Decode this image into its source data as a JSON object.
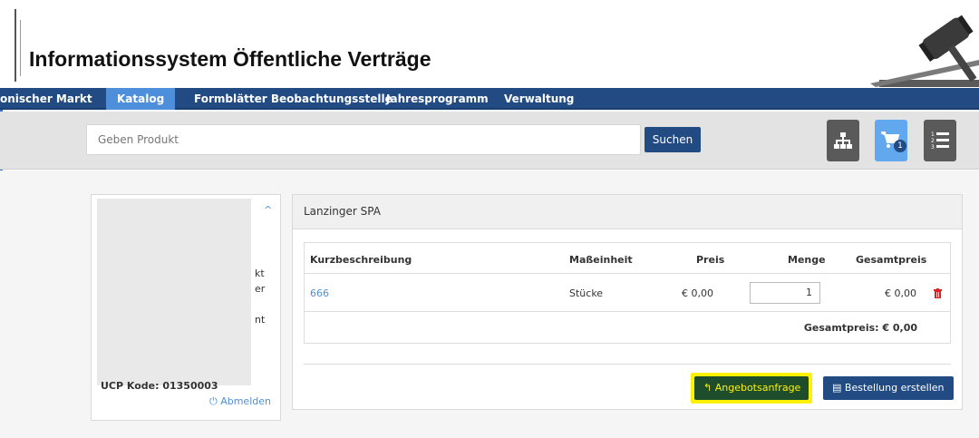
{
  "header": {
    "title": "Informationssystem Öffentliche Verträge"
  },
  "nav": {
    "items": [
      {
        "label": "onischer Markt"
      },
      {
        "label": "Katalog"
      },
      {
        "label": "Formblätter Beobachtungsstelle"
      },
      {
        "label": "Jahresprogramm"
      },
      {
        "label": "Verwaltung"
      }
    ],
    "active_color": "#4e8fdb",
    "bar_color": "#214b82"
  },
  "search": {
    "placeholder": "Geben Produkt",
    "button_label": "Suchen"
  },
  "toolbar": {
    "sitemap_icon": "sitemap-icon",
    "cart_icon": "cart-icon",
    "cart_count": "1",
    "list_icon": "ordered-list-icon"
  },
  "left_panel": {
    "fragments": [
      "kt",
      "er",
      "nt"
    ],
    "ucp": "UCP Kode: 01350003",
    "logout": "Abmelden"
  },
  "order": {
    "supplier": "Lanzinger SPA",
    "columns": [
      "Kurzbeschreibung",
      "Maßeinheit",
      "Preis",
      "Menge",
      "Gesamtpreis"
    ],
    "rows": [
      {
        "description": "666",
        "unit": "Stücke",
        "price": "€ 0,00",
        "quantity": "1",
        "total": "€ 0,00"
      }
    ],
    "grand_total": "Gesamtpreis: € 0,00",
    "request_button": "Angebotsanfrage",
    "create_order_button": "Bestellung erstellen",
    "highlight_color": "#fff200"
  }
}
